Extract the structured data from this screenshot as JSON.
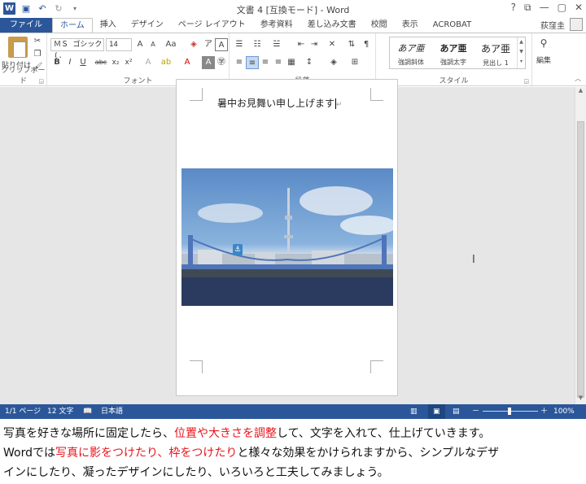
{
  "window": {
    "title": "文書 4 [互換モード] - Word",
    "controls": [
      "?",
      "⧉",
      "—",
      "▢",
      "✕"
    ]
  },
  "qat": {
    "icons": [
      "word-logo",
      "save-icon",
      "undo-icon",
      "redo-icon",
      "customize-icon"
    ]
  },
  "tabs": [
    {
      "label": "ファイル"
    },
    {
      "label": "ホーム"
    },
    {
      "label": "挿入"
    },
    {
      "label": "デザイン"
    },
    {
      "label": "ページ レイアウト"
    },
    {
      "label": "参考資料"
    },
    {
      "label": "差し込み文書"
    },
    {
      "label": "校閲"
    },
    {
      "label": "表示"
    },
    {
      "label": "ACROBAT"
    }
  ],
  "user": {
    "name": "荻窪圭"
  },
  "ribbon": {
    "clipboard": {
      "label": "クリップボード",
      "paste_label": "貼り付け"
    },
    "font": {
      "label": "フォント",
      "font_name": "ＭＳ ゴシック (.",
      "font_size": "14"
    },
    "paragraph": {
      "label": "段落"
    },
    "styles": {
      "label": "スタイル",
      "items": [
        {
          "sample": "あア亜",
          "name": "強調斜体"
        },
        {
          "sample": "あア亜",
          "name": "強調太字"
        },
        {
          "sample": "あア亜",
          "name": "見出し 1"
        }
      ]
    },
    "editing": {
      "label": "編集"
    }
  },
  "document": {
    "text": "暑中お見舞い申し上げます",
    "para_mark": "↵"
  },
  "status": {
    "page": "1/1 ページ",
    "words": "12 文字",
    "language": "日本語",
    "zoom_minus": "－",
    "zoom_plus": "＋",
    "zoom": "100%"
  },
  "caption": {
    "l1a": "写真を好きな場所に固定したら、",
    "l1b": "位置や大きさを調整",
    "l1c": "して、文字を入れて、仕上げていきます。",
    "l2a": "Wordでは",
    "l2b": "写真に影をつけたり、枠をつけたり",
    "l2c": "と様々な効果をかけられますから、シンプルなデザ",
    "l3": "インにしたり、凝ったデザインにしたり、いろいろと工夫してみましょう。",
    "highlight_color": "#e8141c"
  },
  "colors": {
    "accent": "#2b579a"
  }
}
